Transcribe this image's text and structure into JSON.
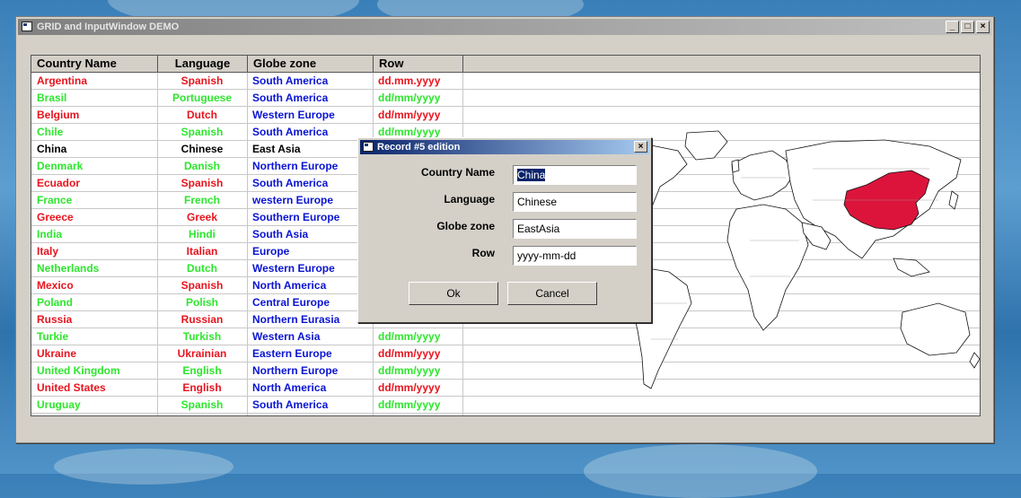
{
  "window": {
    "title": "GRID and InputWindow DEMO",
    "min": "_",
    "max": "□",
    "close": "×"
  },
  "grid": {
    "headers": [
      "Country Name",
      "Language",
      "Globe zone",
      "Row"
    ],
    "rows": [
      {
        "country": "Argentina",
        "language": "Spanish",
        "zone": "South America",
        "row": "dd.mm.yyyy",
        "color": "#e8141e"
      },
      {
        "country": "Brasil",
        "language": "Portuguese",
        "zone": "South America",
        "row": "dd/mm/yyyy",
        "color": "#2ee62e"
      },
      {
        "country": "Belgium",
        "language": "Dutch",
        "zone": "Western Europe",
        "row": "dd/mm/yyyy",
        "color": "#e8141e"
      },
      {
        "country": "Chile",
        "language": "Spanish",
        "zone": "South America",
        "row": "dd/mm/yyyy",
        "color": "#2ee62e"
      },
      {
        "country": "China",
        "language": "Chinese",
        "zone": "East Asia",
        "row": "",
        "color": "#000000"
      },
      {
        "country": "Denmark",
        "language": "Danish",
        "zone": "Northern Europe",
        "row": "",
        "color": "#2ee62e"
      },
      {
        "country": "Ecuador",
        "language": "Spanish",
        "zone": "South America",
        "row": "",
        "color": "#e8141e"
      },
      {
        "country": "France",
        "language": "French",
        "zone": "western Europe",
        "row": "",
        "color": "#2ee62e"
      },
      {
        "country": "Greece",
        "language": "Greek",
        "zone": "Southern Europe",
        "row": "",
        "color": "#e8141e"
      },
      {
        "country": "India",
        "language": "Hindi",
        "zone": "South Asia",
        "row": "",
        "color": "#2ee62e"
      },
      {
        "country": "Italy",
        "language": "Italian",
        "zone": "Europe",
        "row": "",
        "color": "#e8141e"
      },
      {
        "country": "Netherlands",
        "language": "Dutch",
        "zone": "Western Europe",
        "row": "",
        "color": "#2ee62e"
      },
      {
        "country": "Mexico",
        "language": "Spanish",
        "zone": "North America",
        "row": "",
        "color": "#e8141e"
      },
      {
        "country": "Poland",
        "language": "Polish",
        "zone": "Central Europe",
        "row": "",
        "color": "#2ee62e"
      },
      {
        "country": "Russia",
        "language": "Russian",
        "zone": "Northern Eurasia",
        "row": "",
        "color": "#e8141e"
      },
      {
        "country": "Turkie",
        "language": "Turkish",
        "zone": "Western Asia",
        "row": "dd/mm/yyyy",
        "color": "#2ee62e"
      },
      {
        "country": "Ukraine",
        "language": "Ukrainian",
        "zone": "Eastern Europe",
        "row": "dd/mm/yyyy",
        "color": "#e8141e"
      },
      {
        "country": "United Kingdom",
        "language": "English",
        "zone": "Northern Europe",
        "row": "dd/mm/yyyy",
        "color": "#2ee62e"
      },
      {
        "country": "United States",
        "language": "English",
        "zone": "North America",
        "row": "dd/mm/yyyy",
        "color": "#e8141e"
      },
      {
        "country": "Uruguay",
        "language": "Spanish",
        "zone": "South America",
        "row": "dd/mm/yyyy",
        "color": "#2ee62e"
      }
    ],
    "zone_color": "#0a14d2"
  },
  "dialog": {
    "title": "Record #5 edition",
    "close": "×",
    "fields": {
      "country": {
        "label": "Country Name",
        "value": "China"
      },
      "language": {
        "label": "Language",
        "value": "Chinese"
      },
      "zone": {
        "label": "Globe zone",
        "value": "EastAsia"
      },
      "row": {
        "label": "Row",
        "value": "yyyy-mm-dd"
      }
    },
    "ok_label": "Ok",
    "cancel_label": "Cancel"
  },
  "map": {
    "highlight_color": "#dc143c",
    "highlighted_country": "China"
  }
}
